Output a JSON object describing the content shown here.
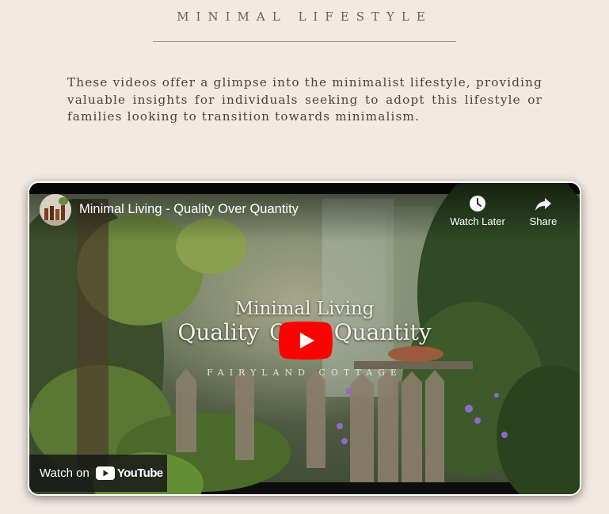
{
  "page": {
    "title": "MINIMAL LIFESTYLE",
    "intro": "These videos offer a glimpse into the minimalist lifestyle, providing valuable insights for individuals seeking to adopt this lifestyle or families looking to transition towards minimalism."
  },
  "video": {
    "title": "Minimal Living - Quality Over Quantity",
    "watch_later_label": "Watch Later",
    "share_label": "Share",
    "watch_on_label": "Watch on",
    "youtube_word": "YouTube",
    "thumbnail_line1": "Minimal Living",
    "thumbnail_line2": "Quality Over Quantity",
    "thumbnail_line3": "FAIRYLAND COTTAGE",
    "icons": {
      "avatar": "channel-avatar",
      "clock": "clock-icon",
      "share": "share-arrow-icon",
      "play": "play-button-icon",
      "youtube": "youtube-logo-icon"
    },
    "colors": {
      "play_red": "#ff0000",
      "background": "#f3e9e3"
    }
  }
}
